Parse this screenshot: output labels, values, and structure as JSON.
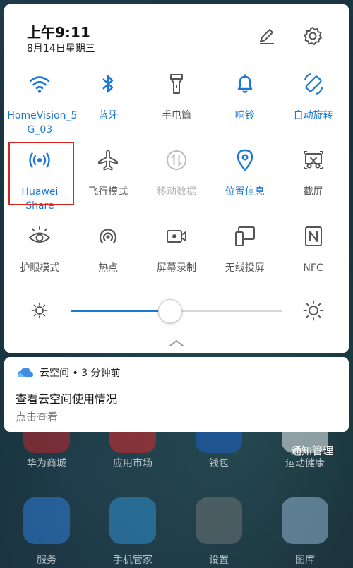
{
  "status": {
    "time": "上午9:11",
    "date": "8月14日星期三"
  },
  "header_icons": [
    "edit-icon",
    "gear-icon"
  ],
  "tiles": [
    {
      "label": "HomeVision_5\nG_03",
      "icon": "wifi-icon",
      "state": "on"
    },
    {
      "label": "蓝牙",
      "icon": "bluetooth-icon",
      "state": "on"
    },
    {
      "label": "手电筒",
      "icon": "flashlight-icon",
      "state": "off"
    },
    {
      "label": "响铃",
      "icon": "bell-icon",
      "state": "on"
    },
    {
      "label": "自动旋转",
      "icon": "rotate-icon",
      "state": "on"
    },
    {
      "label": "Huawei Share",
      "icon": "huawei-share-icon",
      "state": "on"
    },
    {
      "label": "飞行模式",
      "icon": "airplane-icon",
      "state": "off"
    },
    {
      "label": "移动数据",
      "icon": "mobile-data-icon",
      "state": "disabled"
    },
    {
      "label": "位置信息",
      "icon": "location-icon",
      "state": "on"
    },
    {
      "label": "截屏",
      "icon": "screenshot-icon",
      "state": "off"
    },
    {
      "label": "护眼模式",
      "icon": "eye-icon",
      "state": "off"
    },
    {
      "label": "热点",
      "icon": "hotspot-icon",
      "state": "off"
    },
    {
      "label": "屏幕录制",
      "icon": "screen-record-icon",
      "state": "off"
    },
    {
      "label": "无线投屏",
      "icon": "wireless-projection-icon",
      "state": "off"
    },
    {
      "label": "NFC",
      "icon": "nfc-icon",
      "state": "off"
    }
  ],
  "brightness": {
    "level_percent": 47
  },
  "notification": {
    "app": "云空间 • 3 分钟前",
    "title": "查看云空间使用情况",
    "subtitle": "点击查看"
  },
  "notification_manage": "通知管理",
  "home_apps": [
    {
      "label": "华为商城"
    },
    {
      "label": "应用市场"
    },
    {
      "label": "钱包"
    },
    {
      "label": "运动健康"
    },
    {
      "label": "服务"
    },
    {
      "label": "手机管家"
    },
    {
      "label": "设置"
    },
    {
      "label": "图库"
    }
  ],
  "colors": {
    "accent": "#1b78d6",
    "highlight_box": "#d9231f",
    "inactive": "#555555"
  }
}
